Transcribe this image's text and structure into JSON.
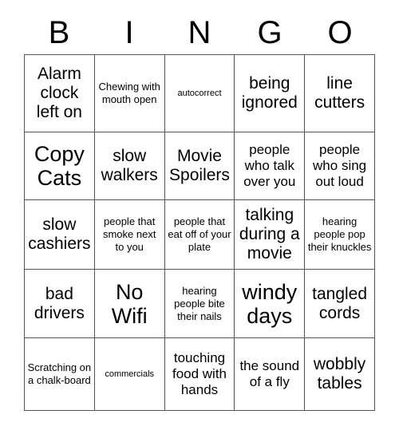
{
  "header": {
    "letters": [
      "B",
      "I",
      "N",
      "G",
      "O"
    ]
  },
  "grid": {
    "rows": [
      [
        {
          "text": "Alarm clock left on",
          "size": "lg"
        },
        {
          "text": "Chewing with mouth open",
          "size": "sm"
        },
        {
          "text": "autocorrect",
          "size": "xs"
        },
        {
          "text": "being ignored",
          "size": "lg"
        },
        {
          "text": "line cutters",
          "size": "lg"
        }
      ],
      [
        {
          "text": "Copy Cats",
          "size": "xl"
        },
        {
          "text": "slow walkers",
          "size": "lg"
        },
        {
          "text": "Movie Spoilers",
          "size": "lg"
        },
        {
          "text": "people who talk over you",
          "size": "md"
        },
        {
          "text": "people who sing out loud",
          "size": "md"
        }
      ],
      [
        {
          "text": "slow cashiers",
          "size": "lg"
        },
        {
          "text": "people that smoke next to you",
          "size": "sm"
        },
        {
          "text": "people that eat off of your plate",
          "size": "sm"
        },
        {
          "text": "talking during a movie",
          "size": "lg"
        },
        {
          "text": "hearing people pop their knuckles",
          "size": "sm"
        }
      ],
      [
        {
          "text": "bad drivers",
          "size": "lg"
        },
        {
          "text": "No Wifi",
          "size": "xl"
        },
        {
          "text": "hearing people bite their nails",
          "size": "sm"
        },
        {
          "text": "windy days",
          "size": "xl"
        },
        {
          "text": "tangled cords",
          "size": "lg"
        }
      ],
      [
        {
          "text": "Scratching on a chalk-board",
          "size": "sm"
        },
        {
          "text": "commercials",
          "size": "xs"
        },
        {
          "text": "touching food with hands",
          "size": "md"
        },
        {
          "text": "the sound of a fly",
          "size": "md"
        },
        {
          "text": "wobbly tables",
          "size": "lg"
        }
      ]
    ]
  },
  "colors": {
    "background": "#ffffff",
    "text": "#000000",
    "border": "#555555"
  }
}
